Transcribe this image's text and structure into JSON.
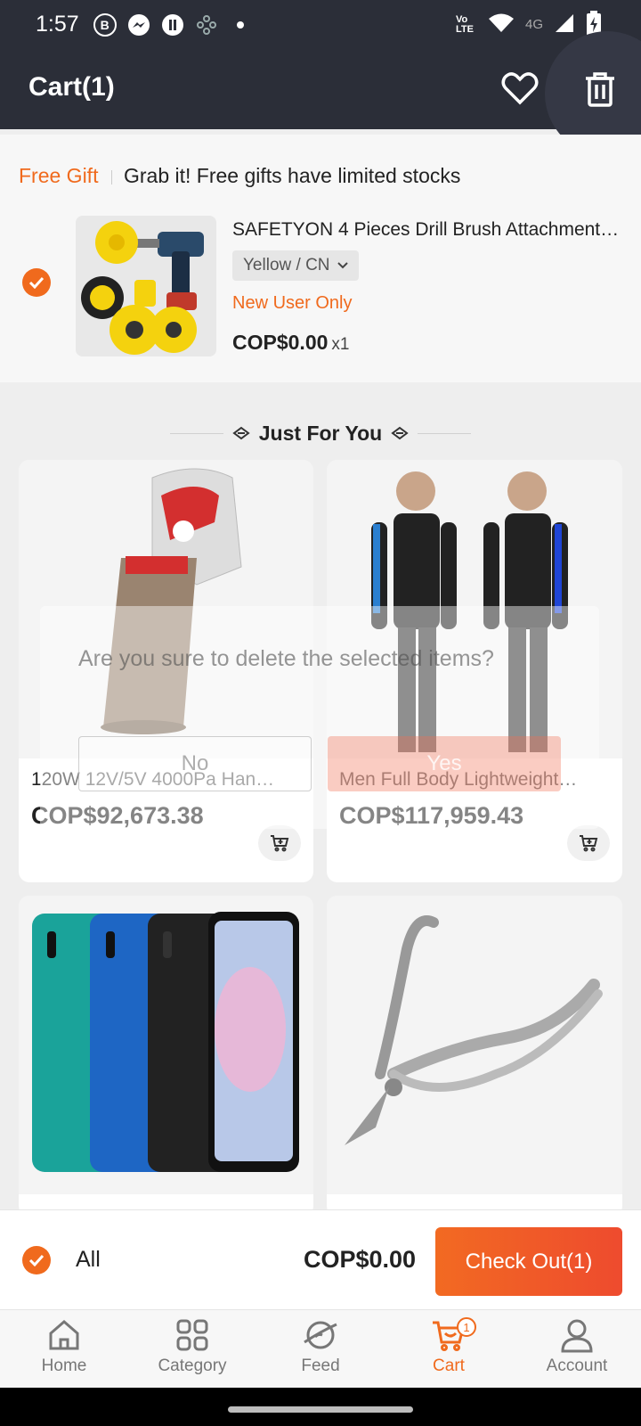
{
  "status_bar": {
    "time": "1:57",
    "icons": [
      "b-icon",
      "messenger-icon",
      "app-icon",
      "gear-cluster-icon",
      "dot-icon"
    ],
    "right_icons": [
      "volte-icon",
      "wifi-icon",
      "signal-4g-icon",
      "battery-charging-icon"
    ],
    "network": "4G",
    "volte": "Vo LTE"
  },
  "header": {
    "title": "Cart(1)",
    "icons": [
      "heart-icon",
      "trash-icon"
    ]
  },
  "gift": {
    "tag": "Free Gift",
    "text": "Grab it! Free gifts have limited stocks",
    "item": {
      "title": "SAFETYON 4 Pieces Drill Brush Attachment…",
      "variant": "Yellow / CN",
      "badge": "New User Only",
      "price": "COP$0.00",
      "qty": "x1",
      "selected": true
    }
  },
  "section": {
    "title": "Just For You"
  },
  "products": [
    {
      "name": "120W 12V/5V 4000Pa Han…",
      "price": "COP$92,673.38"
    },
    {
      "name": "Men Full Body Lightweight…",
      "price": "COP$117,959.43"
    },
    {
      "name": "",
      "price": ""
    },
    {
      "name": "",
      "price": ""
    }
  ],
  "dialog": {
    "message": "Are you sure to delete the selected items?",
    "no_label": "No",
    "yes_label": "Yes"
  },
  "checkout": {
    "all_label": "All",
    "total": "COP$0.00",
    "button_label": "Check Out(1)",
    "all_selected": true
  },
  "tabs": [
    {
      "label": "Home",
      "icon": "home-icon"
    },
    {
      "label": "Category",
      "icon": "category-icon"
    },
    {
      "label": "Feed",
      "icon": "feed-icon"
    },
    {
      "label": "Cart",
      "icon": "cart-icon",
      "badge": "1",
      "active": true
    },
    {
      "label": "Account",
      "icon": "account-icon"
    }
  ],
  "colors": {
    "accent": "#f06a1d",
    "header_bg": "#2b2e38",
    "checkout_gradient_end": "#ee4b2e"
  }
}
